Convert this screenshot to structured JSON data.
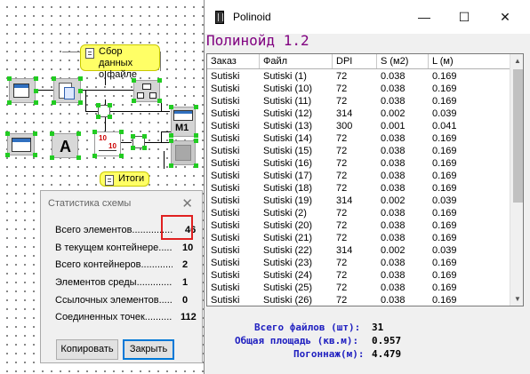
{
  "canvas": {
    "note_collect": [
      "Сбор данных",
      "о файле"
    ],
    "note_totals": "Итоги",
    "text_node_glyph": "A",
    "calc_node_labels": [
      "10",
      "10"
    ],
    "output_node_label": "M1"
  },
  "stats_dialog": {
    "title": "Статистика схемы",
    "close_glyph": "✕",
    "rows": [
      {
        "label": "Всего элементов...........................",
        "value": "46"
      },
      {
        "label": "В текущем контейнере...........",
        "value": "10"
      },
      {
        "label": "Всего контейнеров.....................",
        "value": "2"
      },
      {
        "label": "Элементов среды.......................",
        "value": "1"
      },
      {
        "label": "Ссылочных элементов...........",
        "value": "0"
      },
      {
        "label": "Соединенных точек...............",
        "value": "112"
      }
    ],
    "copy_button": "Копировать",
    "close_button": "Закрыть"
  },
  "polinoid": {
    "window_title": "Polinoid",
    "minimize_glyph": "—",
    "maximize_glyph": "☐",
    "close_glyph": "✕",
    "heading": "Полинойд 1.2",
    "columns": [
      "Заказ",
      "Файл",
      "DPI",
      "S (м2)",
      "L (м)"
    ],
    "rows": [
      [
        "Sutiski",
        "Sutiski (1)",
        "72",
        "0.038",
        "0.169"
      ],
      [
        "Sutiski",
        "Sutiski (10)",
        "72",
        "0.038",
        "0.169"
      ],
      [
        "Sutiski",
        "Sutiski (11)",
        "72",
        "0.038",
        "0.169"
      ],
      [
        "Sutiski",
        "Sutiski (12)",
        "314",
        "0.002",
        "0.039"
      ],
      [
        "Sutiski",
        "Sutiski (13)",
        "300",
        "0.001",
        "0.041"
      ],
      [
        "Sutiski",
        "Sutiski (14)",
        "72",
        "0.038",
        "0.169"
      ],
      [
        "Sutiski",
        "Sutiski (15)",
        "72",
        "0.038",
        "0.169"
      ],
      [
        "Sutiski",
        "Sutiski (16)",
        "72",
        "0.038",
        "0.169"
      ],
      [
        "Sutiski",
        "Sutiski (17)",
        "72",
        "0.038",
        "0.169"
      ],
      [
        "Sutiski",
        "Sutiski (18)",
        "72",
        "0.038",
        "0.169"
      ],
      [
        "Sutiski",
        "Sutiski (19)",
        "314",
        "0.002",
        "0.039"
      ],
      [
        "Sutiski",
        "Sutiski (2)",
        "72",
        "0.038",
        "0.169"
      ],
      [
        "Sutiski",
        "Sutiski (20)",
        "72",
        "0.038",
        "0.169"
      ],
      [
        "Sutiski",
        "Sutiski (21)",
        "72",
        "0.038",
        "0.169"
      ],
      [
        "Sutiski",
        "Sutiski (22)",
        "314",
        "0.002",
        "0.039"
      ],
      [
        "Sutiski",
        "Sutiski (23)",
        "72",
        "0.038",
        "0.169"
      ],
      [
        "Sutiski",
        "Sutiski (24)",
        "72",
        "0.038",
        "0.169"
      ],
      [
        "Sutiski",
        "Sutiski (25)",
        "72",
        "0.038",
        "0.169"
      ],
      [
        "Sutiski",
        "Sutiski (26)",
        "72",
        "0.038",
        "0.169"
      ]
    ],
    "summary": [
      {
        "label": "Всего файлов (шт):",
        "value": "31"
      },
      {
        "label": "Общая площадь (кв.м):",
        "value": "0.957"
      },
      {
        "label": "Погоннаж(м):",
        "value": "4.479"
      }
    ],
    "scroll_up_glyph": "▲",
    "scroll_down_glyph": "▼"
  }
}
